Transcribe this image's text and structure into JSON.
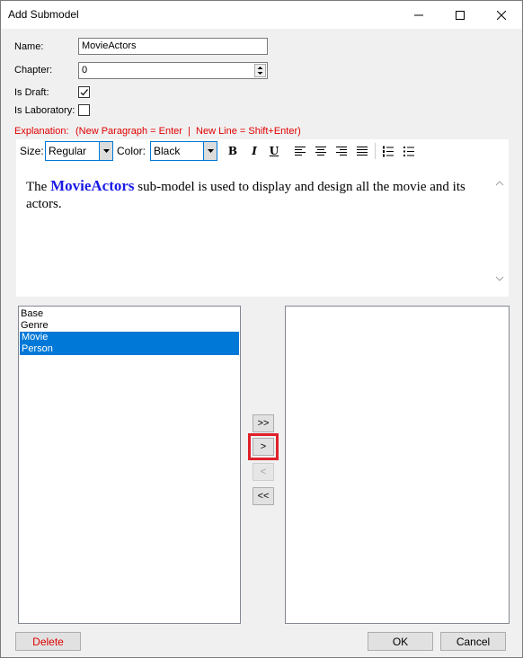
{
  "window": {
    "title": "Add Submodel"
  },
  "form": {
    "name_label": "Name:",
    "name_value": "MovieActors",
    "chapter_label": "Chapter:",
    "chapter_value": "0",
    "draft_label": "Is Draft:",
    "draft_checked": true,
    "lab_label": "Is Laboratory:",
    "lab_checked": false,
    "explanation_label": "Explanation:",
    "explanation_hint": "(New Paragraph = Enter  |  New Line = Shift+Enter)"
  },
  "toolbar": {
    "size_label": "Size:",
    "size_value": "Regular",
    "color_label": "Color:",
    "color_value": "Black"
  },
  "editor": {
    "prefix": "The ",
    "highlight": "MovieActors",
    "suffix": " sub-model is used to display and design all the movie and its actors."
  },
  "lists": {
    "left_items": [
      {
        "label": "Base",
        "selected": false
      },
      {
        "label": "Genre",
        "selected": false
      },
      {
        "label": "Movie",
        "selected": true
      },
      {
        "label": "Person",
        "selected": true
      }
    ],
    "right_items": []
  },
  "move_buttons": {
    "add_all": ">>",
    "add": ">",
    "remove": "<",
    "remove_all": "<<"
  },
  "buttons": {
    "delete": "Delete",
    "ok": "OK",
    "cancel": "Cancel"
  },
  "colors": {
    "accent": "#0078d7",
    "highlight_text": "#1a1ae6",
    "red": "#e00000"
  }
}
